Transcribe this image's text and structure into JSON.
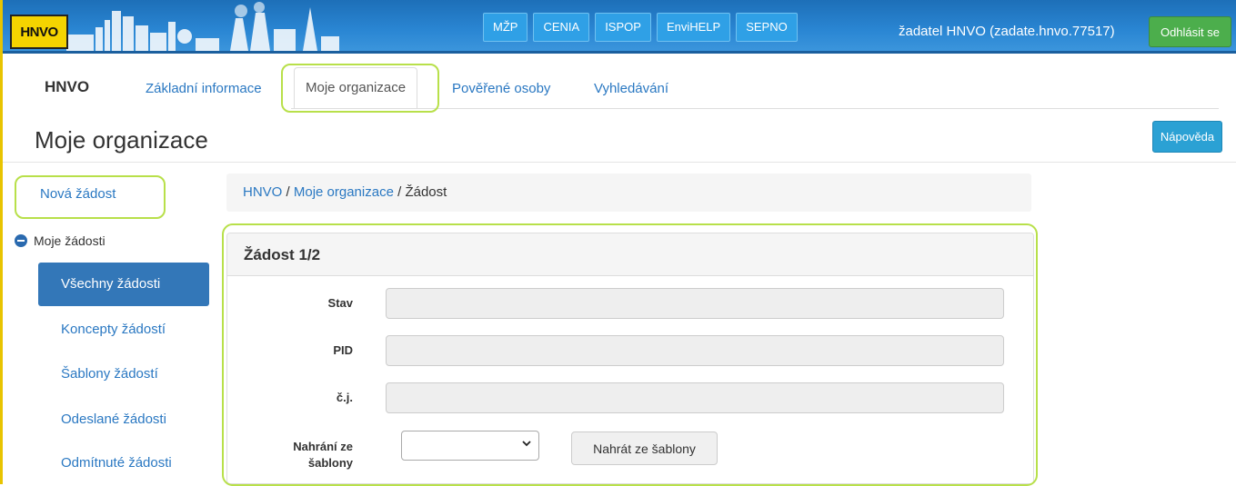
{
  "header": {
    "logo_text": "HNVO",
    "nav_buttons": [
      "MŽP",
      "CENIA",
      "ISPOP",
      "EnviHELP",
      "SEPNO"
    ],
    "user_label": "žadatel HNVO (zadate.hnvo.77517)",
    "logout_label": "Odhlásit se"
  },
  "appnav": {
    "brand": "HNVO",
    "tabs": [
      {
        "label": "Základní informace"
      },
      {
        "label": "Moje organizace"
      },
      {
        "label": "Pověřené osoby"
      },
      {
        "label": "Vyhledávání"
      }
    ],
    "active_tab": "Moje organizace"
  },
  "page": {
    "title": "Moje organizace",
    "help_label": "Nápověda"
  },
  "sidebar": {
    "new_request": "Nová žádost",
    "group_label": "Moje žádosti",
    "items": [
      {
        "label": "Všechny žádosti",
        "active": true
      },
      {
        "label": "Koncepty žádostí"
      },
      {
        "label": "Šablony žádostí"
      },
      {
        "label": "Odeslané žádosti"
      },
      {
        "label": "Odmítnuté žádosti"
      }
    ]
  },
  "breadcrumb": {
    "items": [
      "HNVO",
      "Moje organizace",
      "Žádost"
    ],
    "separator": "/"
  },
  "form": {
    "title": "Žádost 1/2",
    "fields": [
      {
        "label": "Stav",
        "value": ""
      },
      {
        "label": "PID",
        "value": ""
      },
      {
        "label": "č.j.",
        "value": ""
      }
    ],
    "template_label_line1": "Nahrání ze",
    "template_label_line2": "šablony",
    "template_select_value": "",
    "template_button": "Nahrát ze šablony"
  },
  "colors": {
    "header_blue": "#2a86d3",
    "link_blue": "#2a78c2",
    "active_item": "#3377b8",
    "logout_green": "#4cae4c",
    "highlight": "#b8e04a",
    "logo_yellow": "#f5d400"
  }
}
